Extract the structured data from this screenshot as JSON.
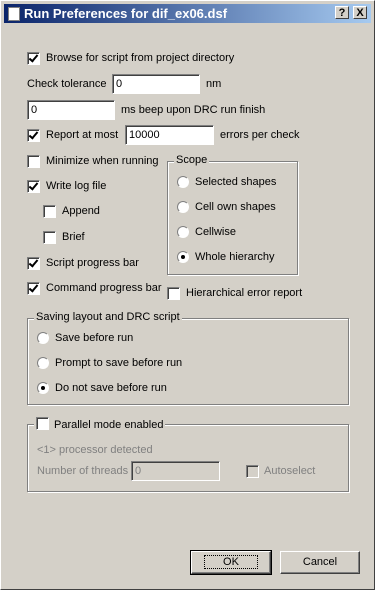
{
  "window": {
    "title": "Run Preferences for dif_ex06.dsf",
    "help_glyph": "?",
    "close_glyph": "X"
  },
  "options": {
    "browse_script": {
      "label": "Browse for script from project directory",
      "checked": true
    },
    "check_tolerance": {
      "label": "Check tolerance",
      "value": "0",
      "unit": "nm"
    },
    "beep": {
      "value": "0",
      "label": "ms beep upon DRC run finish"
    },
    "report_at_most": {
      "label": "Report at most",
      "value": "10000",
      "suffix": "errors per check",
      "checked": true
    },
    "minimize": {
      "label": "Minimize when running",
      "checked": false
    },
    "write_log": {
      "label": "Write log file",
      "checked": true
    },
    "append": {
      "label": "Append",
      "checked": false
    },
    "brief": {
      "label": "Brief",
      "checked": false
    },
    "script_progress": {
      "label": "Script progress bar",
      "checked": true
    },
    "command_progress": {
      "label": "Command  progress bar",
      "checked": true
    },
    "hierarchical_report": {
      "label": "Hierarchical error report",
      "checked": false
    }
  },
  "scope": {
    "legend": "Scope",
    "options": [
      "Selected shapes",
      "Cell own shapes",
      "Cellwise",
      "Whole hierarchy"
    ],
    "selected": "Whole hierarchy"
  },
  "saving": {
    "legend": "Saving layout and DRC script",
    "options": [
      "Save before run",
      "Prompt to save before run",
      "Do not save before run"
    ],
    "selected": "Do not save before run"
  },
  "parallel": {
    "label": "Parallel mode enabled",
    "checked": false,
    "processor_text": "<1> processor detected",
    "threads_label": "Number of threads",
    "threads_value": "0",
    "autoselect_label": "Autoselect"
  },
  "buttons": {
    "ok": "OK",
    "cancel": "Cancel"
  }
}
